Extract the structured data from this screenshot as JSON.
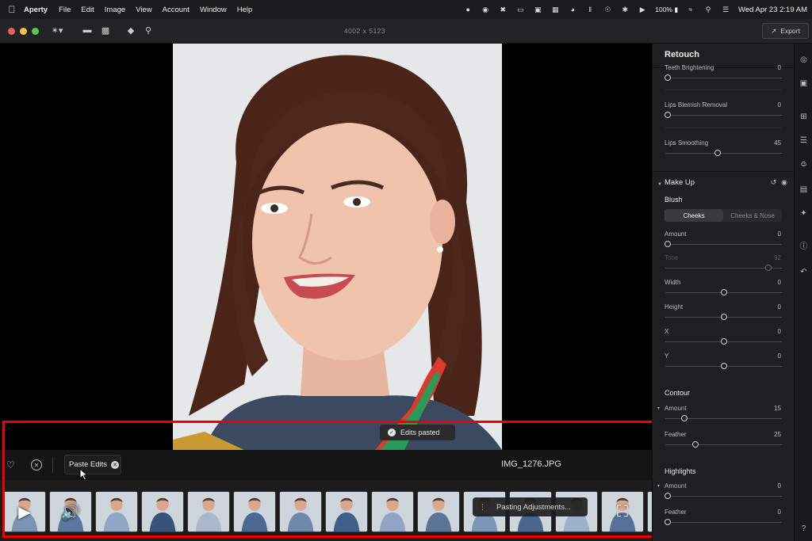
{
  "menubar": {
    "app_name": "Aperty",
    "items": [
      "File",
      "Edit",
      "Image",
      "View",
      "Account",
      "Window",
      "Help"
    ],
    "battery": "100%",
    "clock": "Wed Apr 23  2:19 AM"
  },
  "toolbar": {
    "dimensions": "4002 x 5123",
    "export_label": "Export"
  },
  "canvas": {
    "toast": "Edits pasted"
  },
  "info_bar": {
    "paste_chip_label": "Paste Edits",
    "filename": "IMG_1276.JPG"
  },
  "filmstrip": {
    "status": "Pasting Adjustments...",
    "thumbnail_count": 15
  },
  "panel": {
    "title": "Retouch",
    "top_sliders": [
      {
        "label": "Teeth Brightening",
        "value": "0",
        "fraction": 0.0
      },
      {
        "label": "Lips Blemish Removal",
        "value": "0",
        "fraction": 0.0
      },
      {
        "label": "Lips Smoothing",
        "value": "45",
        "fraction": 0.45
      }
    ],
    "makeup": {
      "title": "Make Up",
      "blush_title": "Blush",
      "tabs": [
        "Cheeks",
        "Cheeks & Nose"
      ],
      "active_tab": "Cheeks",
      "sliders": [
        {
          "label": "Amount",
          "value": "0",
          "fraction": 0.0
        },
        {
          "label": "Tone",
          "value": "92",
          "fraction": 0.9,
          "disabled": true
        },
        {
          "label": "Width",
          "value": "0",
          "fraction": 0.5
        },
        {
          "label": "Height",
          "value": "0",
          "fraction": 0.5
        },
        {
          "label": "X",
          "value": "0",
          "fraction": 0.5
        },
        {
          "label": "Y",
          "value": "0",
          "fraction": 0.5
        }
      ]
    },
    "contour": {
      "title": "Contour",
      "sliders": [
        {
          "label": "Amount",
          "value": "15",
          "fraction": 0.15
        },
        {
          "label": "Feather",
          "value": "25",
          "fraction": 0.25
        }
      ]
    },
    "highlights": {
      "title": "Highlights",
      "sliders": [
        {
          "label": "Amount",
          "value": "0",
          "fraction": 0.0
        },
        {
          "label": "Feather",
          "value": "0",
          "fraction": 0.0
        }
      ]
    }
  },
  "colors": {
    "accent_highlight": "#e00000",
    "panel_bg": "#1f1f21"
  }
}
